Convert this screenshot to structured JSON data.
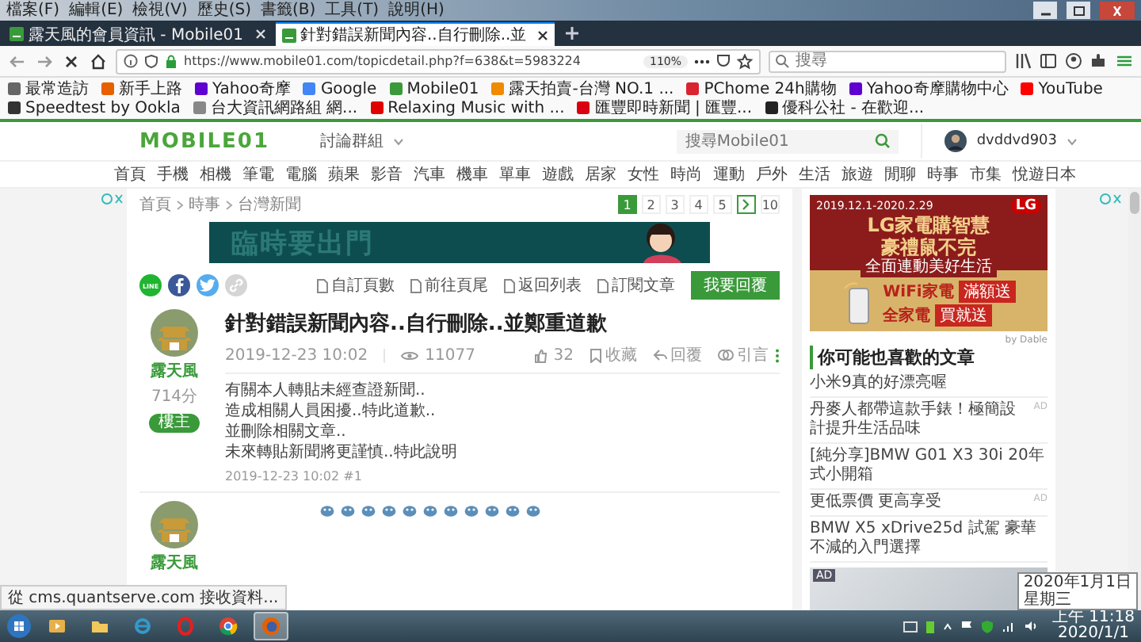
{
  "menu_bar": [
    "檔案(F)",
    "編輯(E)",
    "檢視(V)",
    "歷史(S)",
    "書籤(B)",
    "工具(T)",
    "說明(H)"
  ],
  "tabs": [
    {
      "title": "露天風的會員資訊 - Mobile01",
      "selected": false
    },
    {
      "title": "針對錯誤新聞內容..自行刪除..並",
      "selected": true
    }
  ],
  "address_bar": {
    "url": "https://www.mobile01.com/topicdetail.php?f=638&t=5983224",
    "zoom": "110%"
  },
  "search_bar": {
    "placeholder": "搜尋"
  },
  "bookmarks": [
    {
      "label": "最常造訪",
      "color": "#666666"
    },
    {
      "label": "新手上路",
      "color": "#e66000"
    },
    {
      "label": "Yahoo奇摩",
      "color": "#5f01d1"
    },
    {
      "label": "Google",
      "color": "#4285f4"
    },
    {
      "label": "Mobile01",
      "color": "#3a9a3a"
    },
    {
      "label": "露天拍賣-台灣 NO.1 ...",
      "color": "#f08a00"
    },
    {
      "label": "PChome 24h購物",
      "color": "#d9232e"
    },
    {
      "label": "Yahoo奇摩購物中心",
      "color": "#6001d2"
    },
    {
      "label": "YouTube",
      "color": "#ff0000"
    },
    {
      "label": "Speedtest by Ookla",
      "color": "#333333"
    },
    {
      "label": "台大資訊網路組 網...",
      "color": "#888888"
    },
    {
      "label": "Relaxing Music with ...",
      "color": "#e00000"
    },
    {
      "label": "匯豐即時新聞 | 匯豐...",
      "color": "#db0011"
    },
    {
      "label": "優科公社 - 在歡迎...",
      "color": "#222222"
    }
  ],
  "site_header": {
    "logo": "MOBILE01",
    "forum_menu": "討論群組",
    "search_placeholder": "搜尋Mobile01",
    "username": "dvddvd903"
  },
  "categories": [
    "首頁",
    "手機",
    "相機",
    "筆電",
    "電腦",
    "蘋果",
    "影音",
    "汽車",
    "機車",
    "單車",
    "遊戲",
    "居家",
    "女性",
    "時尚",
    "運動",
    "戶外",
    "生活",
    "旅遊",
    "閒聊",
    "時事",
    "市集",
    "悅遊日本"
  ],
  "breadcrumb": [
    "首頁",
    "時事",
    "台灣新聞"
  ],
  "pagination": [
    {
      "kind": "page",
      "label": "1",
      "selected": true
    },
    {
      "kind": "page",
      "label": "2",
      "selected": false
    },
    {
      "kind": "page",
      "label": "3",
      "selected": false
    },
    {
      "kind": "page",
      "label": "4",
      "selected": false
    },
    {
      "kind": "page",
      "label": "5",
      "selected": false
    },
    {
      "kind": "next",
      "selected": false
    },
    {
      "kind": "page",
      "label": "10",
      "selected": false
    }
  ],
  "top_banner": {
    "text": "臨時要出門"
  },
  "share_buttons": [
    {
      "kind": "line",
      "label": "LINE"
    },
    {
      "kind": "facebook"
    },
    {
      "kind": "twitter"
    },
    {
      "kind": "link"
    }
  ],
  "topic_actions": [
    "自訂頁數",
    "前往頁尾",
    "返回列表",
    "訂閱文章"
  ],
  "reply_button": "我要回覆",
  "post": {
    "author": "露天風",
    "score": "714分",
    "badge": "樓主",
    "title": "針對錯誤新聞內容..自行刪除..並鄭重道歉",
    "date": "2019-12-23 10:02",
    "views": "11077",
    "likes": "32",
    "actions": [
      {
        "kind": "bookmark",
        "label": "收藏"
      },
      {
        "kind": "reply",
        "label": "回覆"
      },
      {
        "kind": "quote",
        "label": "引言"
      }
    ],
    "body": [
      "有關本人轉貼未經查證新聞..",
      "造成相關人員困擾..特此道歉..",
      "並刪除相關文章..",
      "未來轉貼新聞將更謹慎..特此說明"
    ],
    "footer": "2019-12-23 10:02 #1"
  },
  "reply_post": {
    "author": "露天風"
  },
  "sidebar": {
    "ad": {
      "brand": "LG",
      "dates": "2019.12.1-2020.2.29",
      "headline": "LG家電購智慧",
      "subheadline": "豪禮鼠不完",
      "tagline": "全面連動美好生活",
      "offers": [
        {
          "item": "WiFi家電",
          "deal": "滿額送"
        },
        {
          "item": "全家電",
          "deal": "買就送"
        }
      ]
    },
    "by_label": "by Dable",
    "heading": "你可能也喜歡的文章",
    "articles": [
      {
        "title": "小米9真的好漂亮喔"
      },
      {
        "title": "丹麥人都帶這款手錶！極簡設計提升生活品味",
        "ad_label": "AD"
      },
      {
        "title": "[純分享]BMW G01 X3 30i 20年式小開箱"
      },
      {
        "title": "更低票價 更高享受",
        "ad_label": "AD"
      },
      {
        "title": "BMW X5 xDrive25d 試駕 豪華不減的入門選擇"
      }
    ],
    "bottom_ad_label": "AD"
  },
  "status_popup": "從 cms.quantserve.com 接收資料...",
  "taskbar": {
    "apps": [
      {
        "kind": "media",
        "selected": false
      },
      {
        "kind": "folder",
        "selected": false
      },
      {
        "kind": "ie",
        "selected": false
      },
      {
        "kind": "opera",
        "selected": false
      },
      {
        "kind": "chrome",
        "selected": false
      },
      {
        "kind": "firefox",
        "selected": true
      }
    ],
    "time": "上午 11:18",
    "date": "2020/1/1",
    "tooltip": [
      "2020年1月1日",
      "星期三"
    ]
  }
}
